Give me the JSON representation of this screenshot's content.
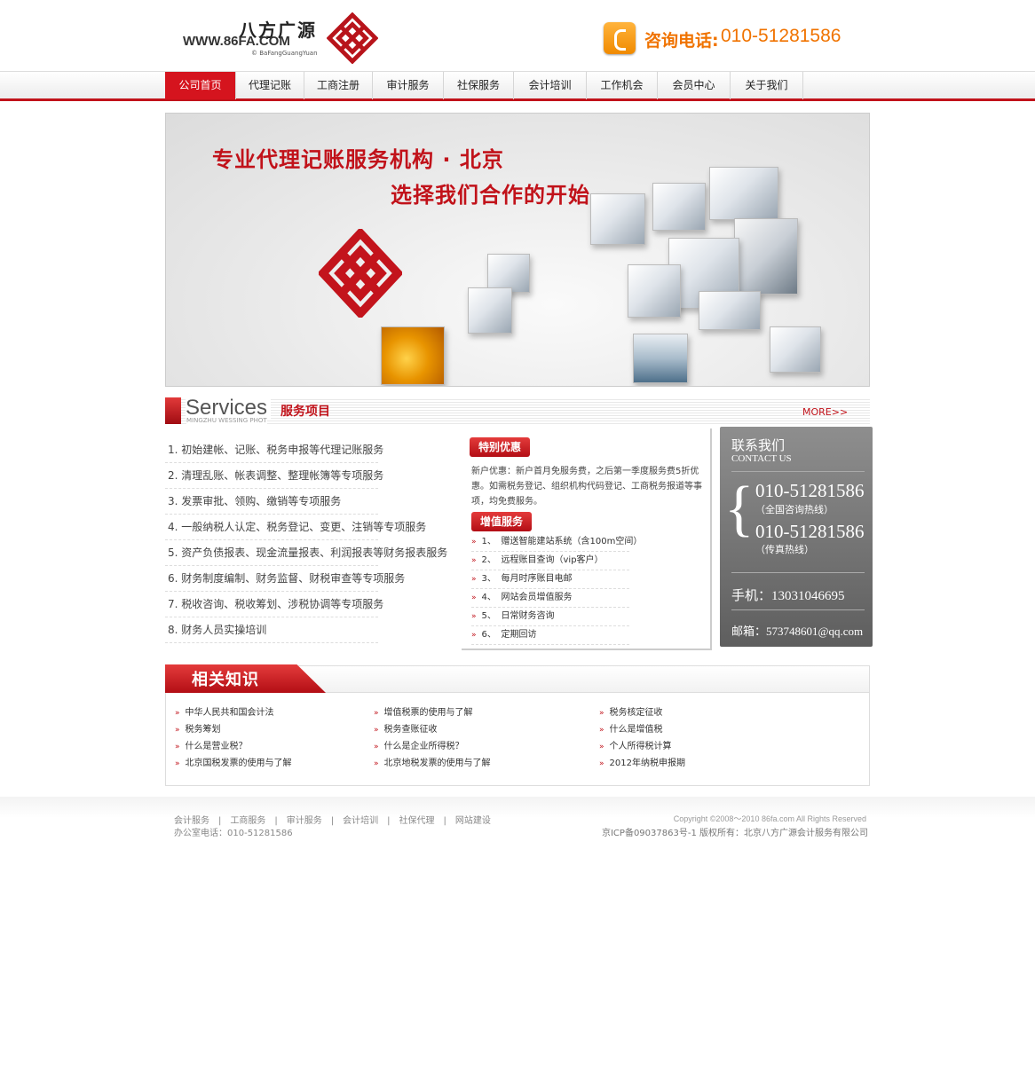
{
  "header": {
    "logo_cn": "八方广源",
    "logo_url": "WWW.86FA.COM",
    "logo_sub": "© BaFangGuangYuan",
    "hotline_label": "咨询电话:",
    "hotline_number": "010-51281586"
  },
  "nav": {
    "items": [
      {
        "label": "公司首页",
        "active": true
      },
      {
        "label": "代理记账"
      },
      {
        "label": "工商注册"
      },
      {
        "label": "审计服务"
      },
      {
        "label": "社保服务"
      },
      {
        "label": "会计培训"
      },
      {
        "label": "工作机会"
      },
      {
        "label": "会员中心"
      },
      {
        "label": "关于我们"
      }
    ]
  },
  "banner": {
    "line1": "专业代理记账服务机构 · 北京",
    "line2": "选择我们合作的开始"
  },
  "services": {
    "title_en": "Services",
    "subtitle_en": "MINGZHU WESSING PHOT",
    "title_cn": "服务项目",
    "more": "MORE>>",
    "items": [
      "1. 初始建帐、记账、税务申报等代理记账服务",
      "2. 清理乱账、帐表调整、整理帐簿等专项服务",
      "3. 发票审批、领购、缴销等专项服务",
      "4. 一般纳税人认定、税务登记、变更、注销等专项服务",
      "5. 资产负债报表、现金流量报表、利润报表等财务报表服务",
      "6. 财务制度编制、财务监督、财税审查等专项服务",
      "7. 税收咨询、税收筹划、涉税协调等专项服务",
      "8. 财务人员实操培训"
    ]
  },
  "promo": {
    "tag": "特别优惠",
    "text": "新户优惠：新户首月免服务费，之后第一季度服务费5折优惠。如需税务登记、组织机构代码登记、工商税务报道等事项，均免费服务。"
  },
  "vas": {
    "tag": "增值服务",
    "items": [
      {
        "num": "1、",
        "label": "赠送智能建站系统（含100m空间）"
      },
      {
        "num": "2、",
        "label": "远程账目查询（vip客户）"
      },
      {
        "num": "3、",
        "label": "每月时序账目电邮"
      },
      {
        "num": "4、",
        "label": "网站会员增值服务"
      },
      {
        "num": "5、",
        "label": "日常财务咨询"
      },
      {
        "num": "6、",
        "label": "定期回访"
      }
    ]
  },
  "contact": {
    "title": "联系我们",
    "subtitle": "CONTACT US",
    "phone1": "010-51281586",
    "phone1_note": "（全国咨询热线）",
    "phone2": "010-51281586",
    "phone2_note": "（传真热线）",
    "mobile": "手机：13031046695",
    "email": "邮箱：573748601@qq.com"
  },
  "knowledge": {
    "title": "相关知识",
    "columns": [
      [
        "中华人民共和国会计法",
        "税务筹划",
        "什么是营业税？",
        "北京国税发票的使用与了解"
      ],
      [
        "增值税票的使用与了解",
        "税务查账征收",
        "什么是企业所得税？",
        "北京地税发票的使用与了解"
      ],
      [
        "税务核定征收",
        "什么是增值税",
        "个人所得税计算",
        "2012年纳税申报期"
      ]
    ]
  },
  "footer": {
    "links": [
      "会计服务",
      "工商服务",
      "审计服务",
      "会计培训",
      "社保代理",
      "网站建设"
    ],
    "office_phone": "办公室电话：010-51281586",
    "copyright": "Copyright ©2008～2010 86fa.com All Rights Reserved",
    "icp": "京ICP备09037863号-1    版权所有：北京八方广源会计服务有限公司"
  },
  "colors": {
    "brand_red": "#c1121a",
    "hotline_orange": "#f07300",
    "contact_gray": "#7a7a7a"
  },
  "icons": [
    "phone-icon",
    "logo-knot-icon",
    "arrow-right-icon"
  ]
}
